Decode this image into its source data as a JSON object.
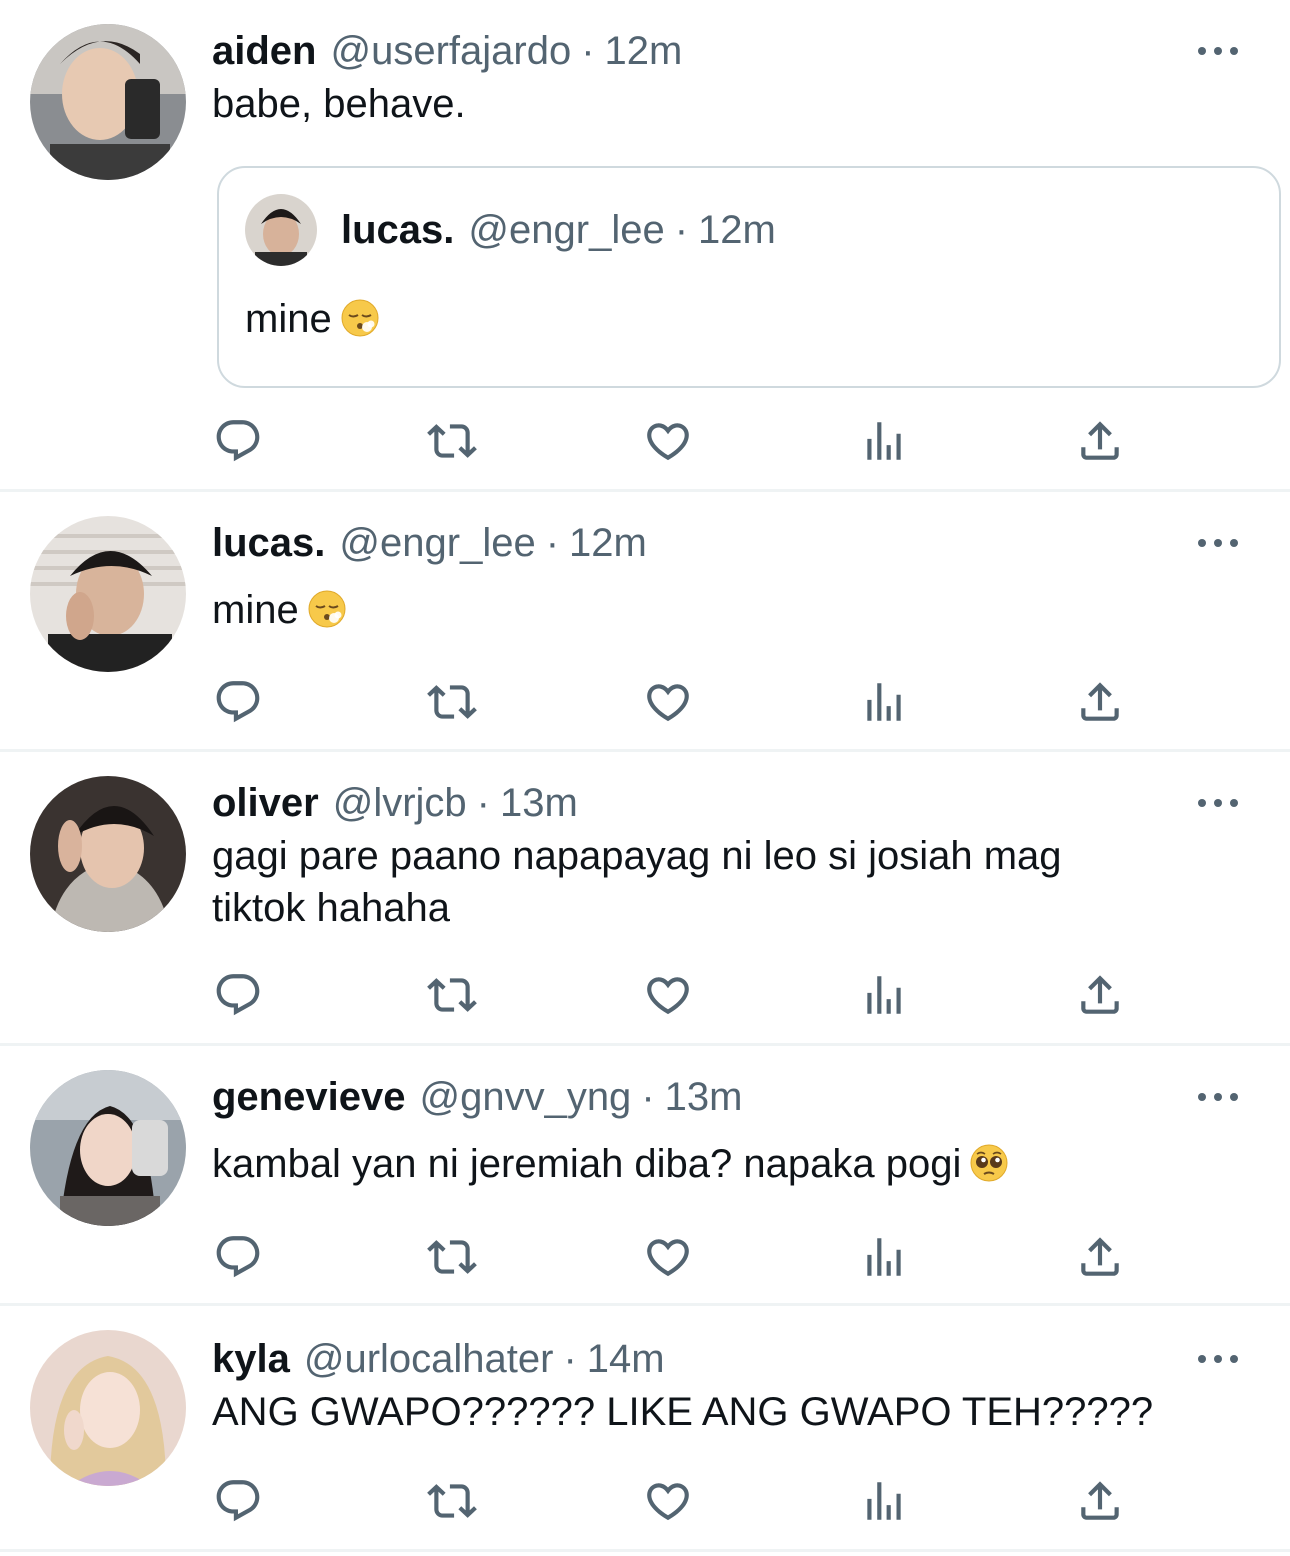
{
  "colors": {
    "text": "#0f1419",
    "muted": "#536471",
    "divider": "#eff3f4",
    "quote_border": "#cfd9de"
  },
  "tweets": [
    {
      "name": "aiden",
      "handle": "@userfajardo",
      "dot": "·",
      "time": "12m",
      "text": "babe, behave.",
      "quote": {
        "name": "lucas.",
        "handle": "@engr_lee",
        "dot": "·",
        "time": "12m",
        "text": "mine",
        "emoji": "face-exhaling-emoji"
      }
    },
    {
      "name": "lucas.",
      "handle": "@engr_lee",
      "dot": "·",
      "time": "12m",
      "text": "mine",
      "emoji": "face-exhaling-emoji"
    },
    {
      "name": "oliver",
      "handle": "@lvrjcb",
      "dot": "·",
      "time": "13m",
      "text_line1": "gagi pare paano napapayag ni leo si josiah mag",
      "text_line2": "tiktok hahaha"
    },
    {
      "name": "genevieve",
      "handle": "@gnvv_yng",
      "dot": "·",
      "time": "13m",
      "text": "kambal yan ni jeremiah diba? napaka pogi",
      "emoji": "pleading-face-emoji"
    },
    {
      "name": "kyla",
      "handle": "@urlocalhater",
      "dot": "·",
      "time": "14m",
      "text": "ANG GWAPO?????? LIKE ANG GWAPO TEH?????"
    }
  ],
  "action_icons": [
    "reply-icon",
    "retweet-icon",
    "like-icon",
    "views-icon",
    "share-icon"
  ]
}
